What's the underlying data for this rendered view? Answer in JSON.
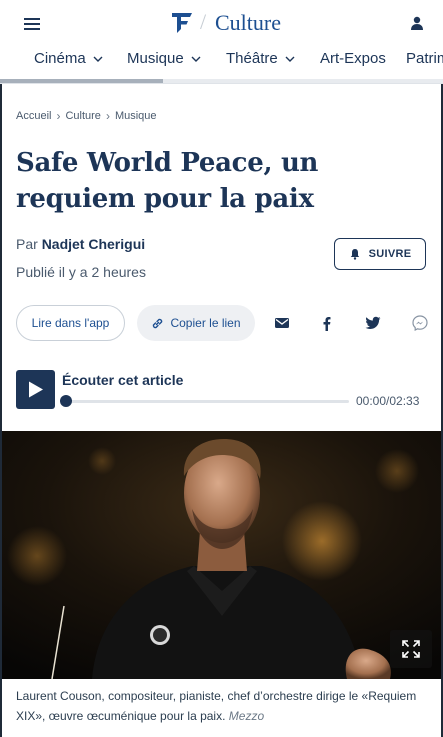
{
  "header": {
    "section_name": "Culture",
    "menu_icon": "hamburger-menu-icon",
    "logo_icon": "le-figaro-logo-icon",
    "account_icon": "user-icon"
  },
  "nav": {
    "items": [
      {
        "label": "Cinéma",
        "has_dropdown": true
      },
      {
        "label": "Musique",
        "has_dropdown": true
      },
      {
        "label": "Théâtre",
        "has_dropdown": true
      },
      {
        "label": "Art-Expos",
        "has_dropdown": false
      },
      {
        "label": "Patrim",
        "has_dropdown": false
      }
    ]
  },
  "breadcrumb": {
    "items": [
      "Accueil",
      "Culture",
      "Musique"
    ]
  },
  "article": {
    "title": "Safe World Peace, un requiem pour la paix",
    "by_prefix": "Par",
    "author": "Nadjet Cherigui",
    "published": "Publié il y a 2 heures",
    "follow_label": "SUIVRE"
  },
  "actions": {
    "read_in_app": "Lire dans l'app",
    "copy_link": "Copier le lien",
    "share_icons": [
      "email-icon",
      "facebook-icon",
      "twitter-icon",
      "messenger-icon"
    ]
  },
  "audio": {
    "title": "Écouter cet article",
    "time": "00:00/02:33",
    "progress": 0
  },
  "photo": {
    "caption": "Laurent Couson, compositeur, pianiste, chef d’orchestre dirige le «Requiem XIX», œuvre œcuménique pour la paix.",
    "credit": "Mezzo"
  },
  "colors": {
    "navy": "#1d3557",
    "link_blue": "#1d4f91",
    "muted": "#4a5a6d"
  }
}
